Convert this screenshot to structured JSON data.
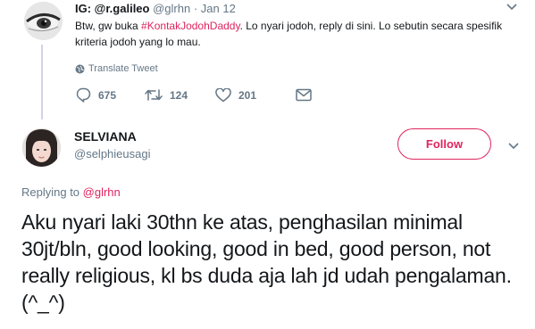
{
  "parent_tweet": {
    "display_name": "IG: @r.galileo",
    "handle": "@glrhn",
    "date_sep": " · ",
    "date": "Jan 12",
    "text_before": "Btw, gw buka ",
    "hashtag": "#KontakJodohDaddy",
    "text_after": ". Lo nyari jodoh, reply di sini. Lo sebutin secara spesifik kriteria jodoh yang lo mau.",
    "translate_label": "Translate Tweet",
    "reply_count": "675",
    "retweet_count": "124",
    "like_count": "201"
  },
  "reply_tweet": {
    "display_name": "SELVIANA",
    "handle": "@selphieusagi",
    "follow_label": "Follow",
    "replying_prefix": "Replying to ",
    "replying_to": "@glrhn",
    "text": "Aku nyari laki 30thn ke atas, penghasilan minimal 30jt/bln, good looking, good in bed, good person, not really religious, kl bs duda aja lah jd udah pengalaman. (^_^)"
  },
  "colors": {
    "accent": "#e0245e",
    "secondary_text": "#657786",
    "primary_text": "#14171a",
    "thread_line": "#d8cfe6"
  }
}
